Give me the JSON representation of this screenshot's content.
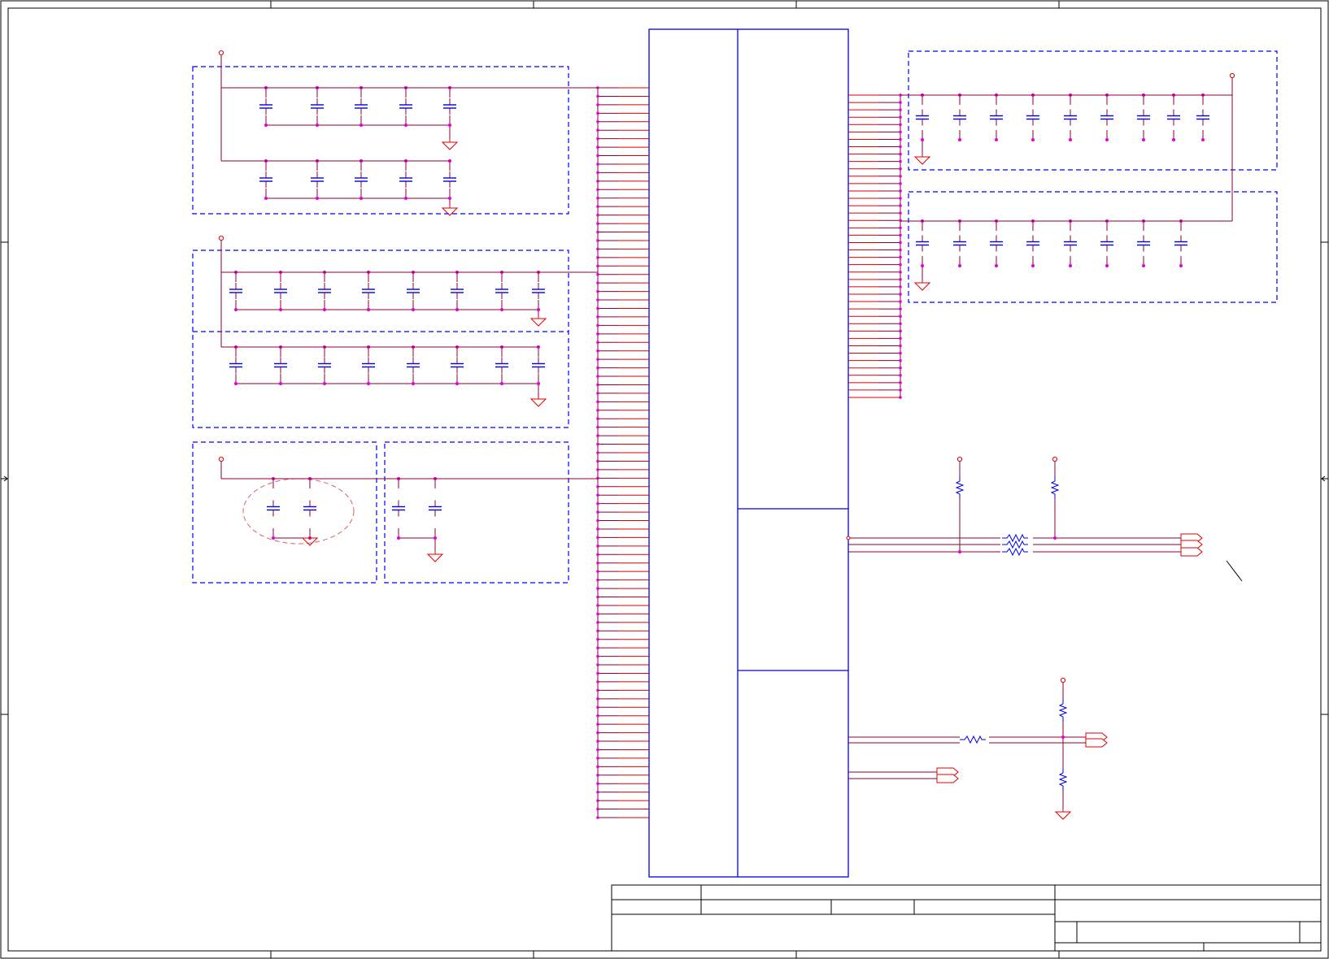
{
  "sheet": {
    "kind": "schematic",
    "colors": {
      "border": "#000000",
      "net": "#8b0033",
      "pin": "#e00000",
      "component": "#0000e0",
      "junction": "#e000e0",
      "group_box": "#0000ff",
      "highlight": "#e06060"
    }
  },
  "components": {
    "decoupling_groups": [
      {
        "id": "group-1a",
        "capacitors": 5
      },
      {
        "id": "group-1b",
        "capacitors": 5
      },
      {
        "id": "group-2a",
        "capacitors": 8
      },
      {
        "id": "group-2b",
        "capacitors": 8
      },
      {
        "id": "group-3a",
        "capacitors": 2
      },
      {
        "id": "group-3b",
        "capacitors": 2
      },
      {
        "id": "group-right-a",
        "capacitors": 9
      },
      {
        "id": "group-right-b",
        "capacitors": 8
      }
    ],
    "ic": {
      "sections": 4,
      "left_pins": 87,
      "right_pins": 42
    },
    "resistors": {
      "pullups": 2,
      "series_pair": 2,
      "divider": 3
    },
    "ports": {
      "off_sheet_connectors": 5
    }
  }
}
